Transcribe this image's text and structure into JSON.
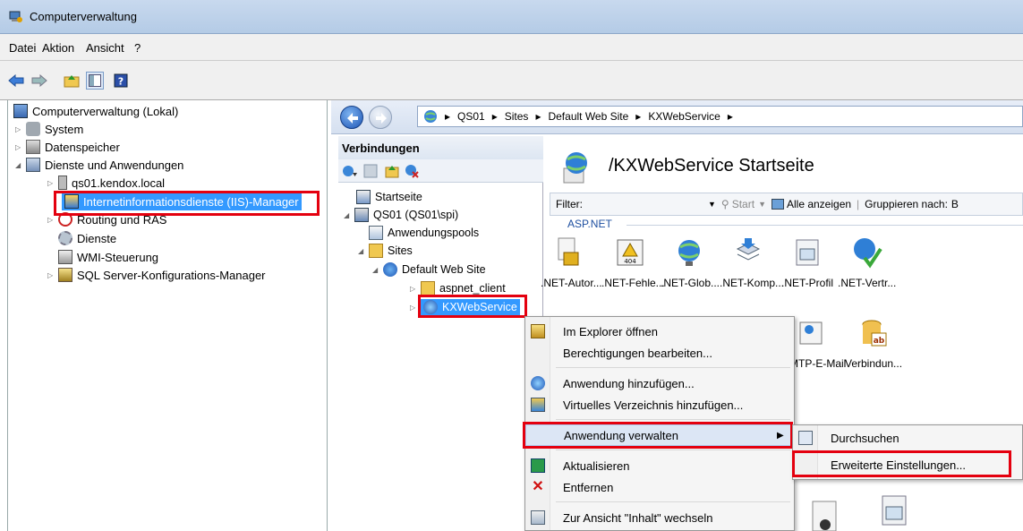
{
  "window": {
    "title": "Computerverwaltung"
  },
  "menu": [
    "Datei",
    "Aktion",
    "Ansicht",
    "?"
  ],
  "left_tree": [
    {
      "label": "Computerverwaltung (Lokal)",
      "icon": "computer-icon"
    },
    {
      "label": "System",
      "icon": "tools-icon"
    },
    {
      "label": "Datenspeicher",
      "icon": "storage-icon"
    },
    {
      "label": "Dienste und Anwendungen",
      "icon": "services-apps-icon"
    },
    {
      "label": "qs01.kendox.local",
      "icon": "server-icon"
    },
    {
      "label": "Internetinformationsdienste (IIS)-Manager",
      "icon": "iis-icon"
    },
    {
      "label": "Routing und RAS",
      "icon": "routing-icon"
    },
    {
      "label": "Dienste",
      "icon": "gear-icon"
    },
    {
      "label": "WMI-Steuerung",
      "icon": "wmi-icon"
    },
    {
      "label": "SQL Server-Konfigurations-Manager",
      "icon": "sql-icon"
    }
  ],
  "breadcrumb": [
    "QS01",
    "Sites",
    "Default Web Site",
    "KXWebService"
  ],
  "connections": {
    "title": "Verbindungen",
    "tree": [
      {
        "label": "Startseite",
        "icon": "home-icon"
      },
      {
        "label": "QS01 (QS01\\spi)",
        "icon": "server-icon"
      },
      {
        "label": "Anwendungspools",
        "icon": "app-pool-icon"
      },
      {
        "label": "Sites",
        "icon": "folder-icon"
      },
      {
        "label": "Default Web Site",
        "icon": "globe-icon"
      },
      {
        "label": "aspnet_client",
        "icon": "folder-icon"
      },
      {
        "label": "KXWebService",
        "icon": "web-app-icon"
      }
    ]
  },
  "startpage": {
    "title": "/KXWebService Startseite",
    "filter_label": "Filter:",
    "start_label": "Start",
    "show_all_label": "Alle anzeigen",
    "group_by_label": "Gruppieren nach:",
    "group_by_value": "B",
    "group_name": "ASP.NET",
    "features": [
      ".NET-Autor...",
      ".NET-Fehle...",
      ".NET-Glob...",
      ".NET-Komp...",
      ".NET-Profil",
      ".NET-Vertr..."
    ],
    "features_row2": [
      "SMTP-E-Mail",
      "Verbindun..."
    ]
  },
  "context_menu": [
    "Im Explorer öffnen",
    "Berechtigungen bearbeiten...",
    "Anwendung hinzufügen...",
    "Virtuelles Verzeichnis hinzufügen...",
    "Anwendung verwalten",
    "Aktualisieren",
    "Entfernen",
    "Zur Ansicht \"Inhalt\" wechseln"
  ],
  "submenu": [
    "Durchsuchen",
    "Erweiterte Einstellungen..."
  ],
  "colors": {
    "highlight": "#e4000f",
    "selection": "#3399ff",
    "link": "#1e4fa0"
  }
}
